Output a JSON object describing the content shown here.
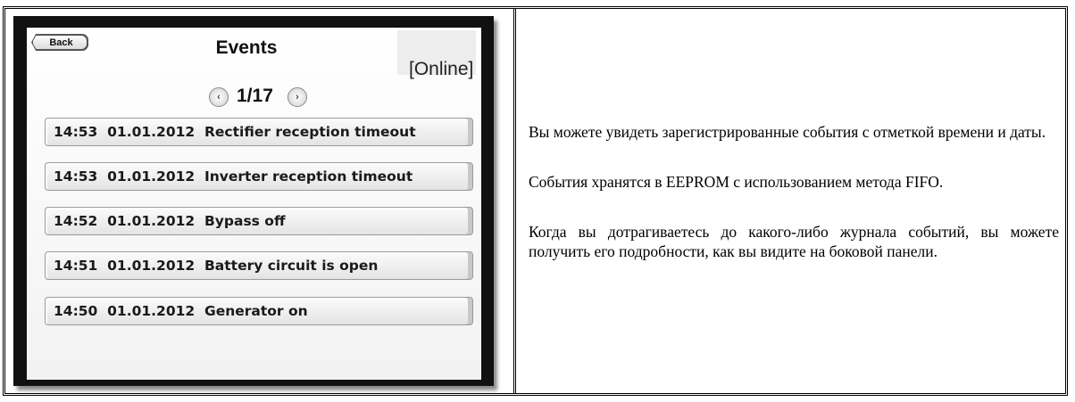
{
  "device": {
    "back_label": "Back",
    "title": "Events",
    "status": "[Online]",
    "pager": {
      "prev_icon": "chevron-left-icon",
      "next_icon": "chevron-right-icon",
      "page_text": "1/17"
    },
    "events": [
      {
        "text": "14:53  01.01.2012  Rectifier reception timeout"
      },
      {
        "text": "14:53  01.01.2012  Inverter reception timeout"
      },
      {
        "text": "14:52  01.01.2012  Bypass off"
      },
      {
        "text": "14:51  01.01.2012  Battery circuit is open"
      },
      {
        "text": "14:50  01.01.2012  Generator on"
      }
    ]
  },
  "description": {
    "paragraphs": [
      "Вы можете увидеть зарегистрированные события с отметкой времени и даты.",
      "События хранятся в EEPROM с использованием метода FIFO.",
      "Когда вы дотрагиваетесь до какого-либо журнала событий, вы можете получить его подробности, как вы видите на боковой панели."
    ]
  }
}
